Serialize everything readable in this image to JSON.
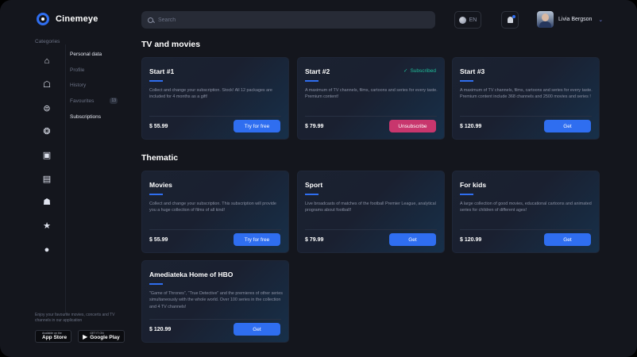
{
  "app": {
    "name": "Cinemeye"
  },
  "sidebar": {
    "categories_label": "Categories",
    "rail_icons": [
      {
        "name": "home-icon",
        "glyph": "⌂"
      },
      {
        "name": "robot-icon",
        "glyph": "☖"
      },
      {
        "name": "theater-icon",
        "glyph": "⊜"
      },
      {
        "name": "dragon-icon",
        "glyph": "❂"
      },
      {
        "name": "film-icon",
        "glyph": "▣"
      },
      {
        "name": "clapper-icon",
        "glyph": "▤"
      },
      {
        "name": "cat-icon",
        "glyph": "☗"
      },
      {
        "name": "star-icon",
        "glyph": "★"
      },
      {
        "name": "user-icon",
        "glyph": "●"
      }
    ],
    "submenu": [
      {
        "label": "Personal data",
        "active": true
      },
      {
        "label": "Profile",
        "active": false
      },
      {
        "label": "History",
        "active": false
      },
      {
        "label": "Favourites",
        "active": false,
        "badge": "13"
      },
      {
        "label": "Subscriptions",
        "active": true
      }
    ],
    "promo_text": "Enjoy your favourite movies, concerts and TV channels in our application",
    "stores": [
      {
        "small": "Available on the",
        "big": "App Store",
        "glyph": ""
      },
      {
        "small": "GET IT ON",
        "big": "Google Play",
        "glyph": "▶"
      }
    ]
  },
  "topbar": {
    "search_placeholder": "Search",
    "language": "EN",
    "user_name": "Livia Bergson",
    "chevron": "⌄"
  },
  "sections": [
    {
      "title": "TV and movies",
      "cards": [
        {
          "title": "Start #1",
          "desc": "Collect and change your subscription. Stock! All 12 packages are included for 4 months as a gift!",
          "price": "$ 55.99",
          "button": "Try for free",
          "button_style": "primary",
          "status": ""
        },
        {
          "title": "Start #2",
          "desc": "A maximum of TV channels, films, cartoons and series for every taste. Premium content!",
          "price": "$ 79.99",
          "button": "Unsubscribe",
          "button_style": "danger",
          "status": "Subscribed"
        },
        {
          "title": "Start #3",
          "desc": "A maximum of TV channels, films, cartoons and series for every taste. Premium content include 368 channels and 2500 movies and series !",
          "price": "$ 120.99",
          "button": "Get",
          "button_style": "primary",
          "status": ""
        }
      ]
    },
    {
      "title": "Thematic",
      "cards": [
        {
          "title": "Movies",
          "desc": "Collect and change your subscription. This subscription will provide you a huge collection of films of all kind!",
          "price": "$ 55.99",
          "button": "Try for free",
          "button_style": "primary",
          "status": ""
        },
        {
          "title": "Sport",
          "desc": "Live broadcasts of matches of the football Premier League, analytical programs about football!",
          "price": "$ 79.99",
          "button": "Get",
          "button_style": "primary",
          "status": ""
        },
        {
          "title": "For kids",
          "desc": "A large collection of good movies, educational cartoons and animated series for children of different ages!",
          "price": "$ 120.99",
          "button": "Get",
          "button_style": "primary",
          "status": ""
        },
        {
          "title": "Amediateka Home of HBO",
          "desc": "\"Game of Thrones\", \"True Detective\" and the premieres of other series simultaneously with the whole world. Over 100 series in the collection and 4 TV channels!",
          "price": "$ 120.99",
          "button": "Get",
          "button_style": "primary",
          "status": ""
        }
      ]
    }
  ],
  "colors": {
    "accent": "#2f6ef0",
    "danger": "#c8366d",
    "success": "#1fbf9b",
    "background": "#14161d",
    "card": "#1b2231"
  }
}
